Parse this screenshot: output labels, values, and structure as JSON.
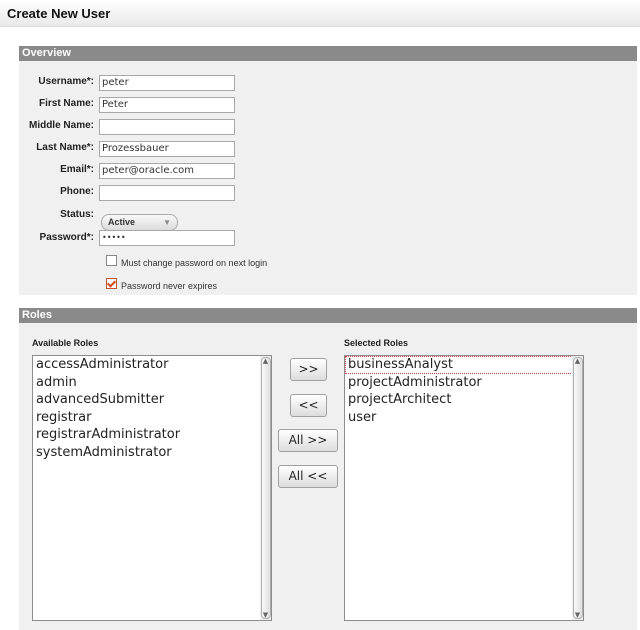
{
  "page": {
    "title": "Create New User"
  },
  "overview": {
    "header": "Overview",
    "fields": {
      "username": {
        "label": "Username*:",
        "value": "peter"
      },
      "first_name": {
        "label": "First Name:",
        "value": "Peter"
      },
      "middle_name": {
        "label": "Middle Name:",
        "value": ""
      },
      "last_name": {
        "label": "Last Name*:",
        "value": "Prozessbauer"
      },
      "email": {
        "label": "Email*:",
        "value": "peter@oracle.com"
      },
      "phone": {
        "label": "Phone:",
        "value": ""
      },
      "status": {
        "label": "Status:",
        "value": "Active"
      },
      "password": {
        "label": "Password*:",
        "value": "•••••"
      }
    },
    "checkboxes": {
      "must_change": {
        "label": "Must change password on next login",
        "checked": false
      },
      "never_expires": {
        "label": "Password never expires",
        "checked": true
      }
    }
  },
  "roles": {
    "header": "Roles",
    "available_label": "Available Roles",
    "selected_label": "Selected Roles",
    "available": [
      "accessAdministrator",
      "admin",
      "advancedSubmitter",
      "registrar",
      "registrarAdministrator",
      "systemAdministrator"
    ],
    "selected": [
      "businessAnalyst",
      "projectAdministrator",
      "projectArchitect",
      "user"
    ],
    "buttons": {
      "add": ">>",
      "remove": "<<",
      "add_all": "All >>",
      "remove_all": "All <<"
    }
  },
  "colors": {
    "panel_header": "#8a8a8a",
    "panel_bg": "#f0f0f0",
    "checkbox_accent": "#d24a1a"
  }
}
